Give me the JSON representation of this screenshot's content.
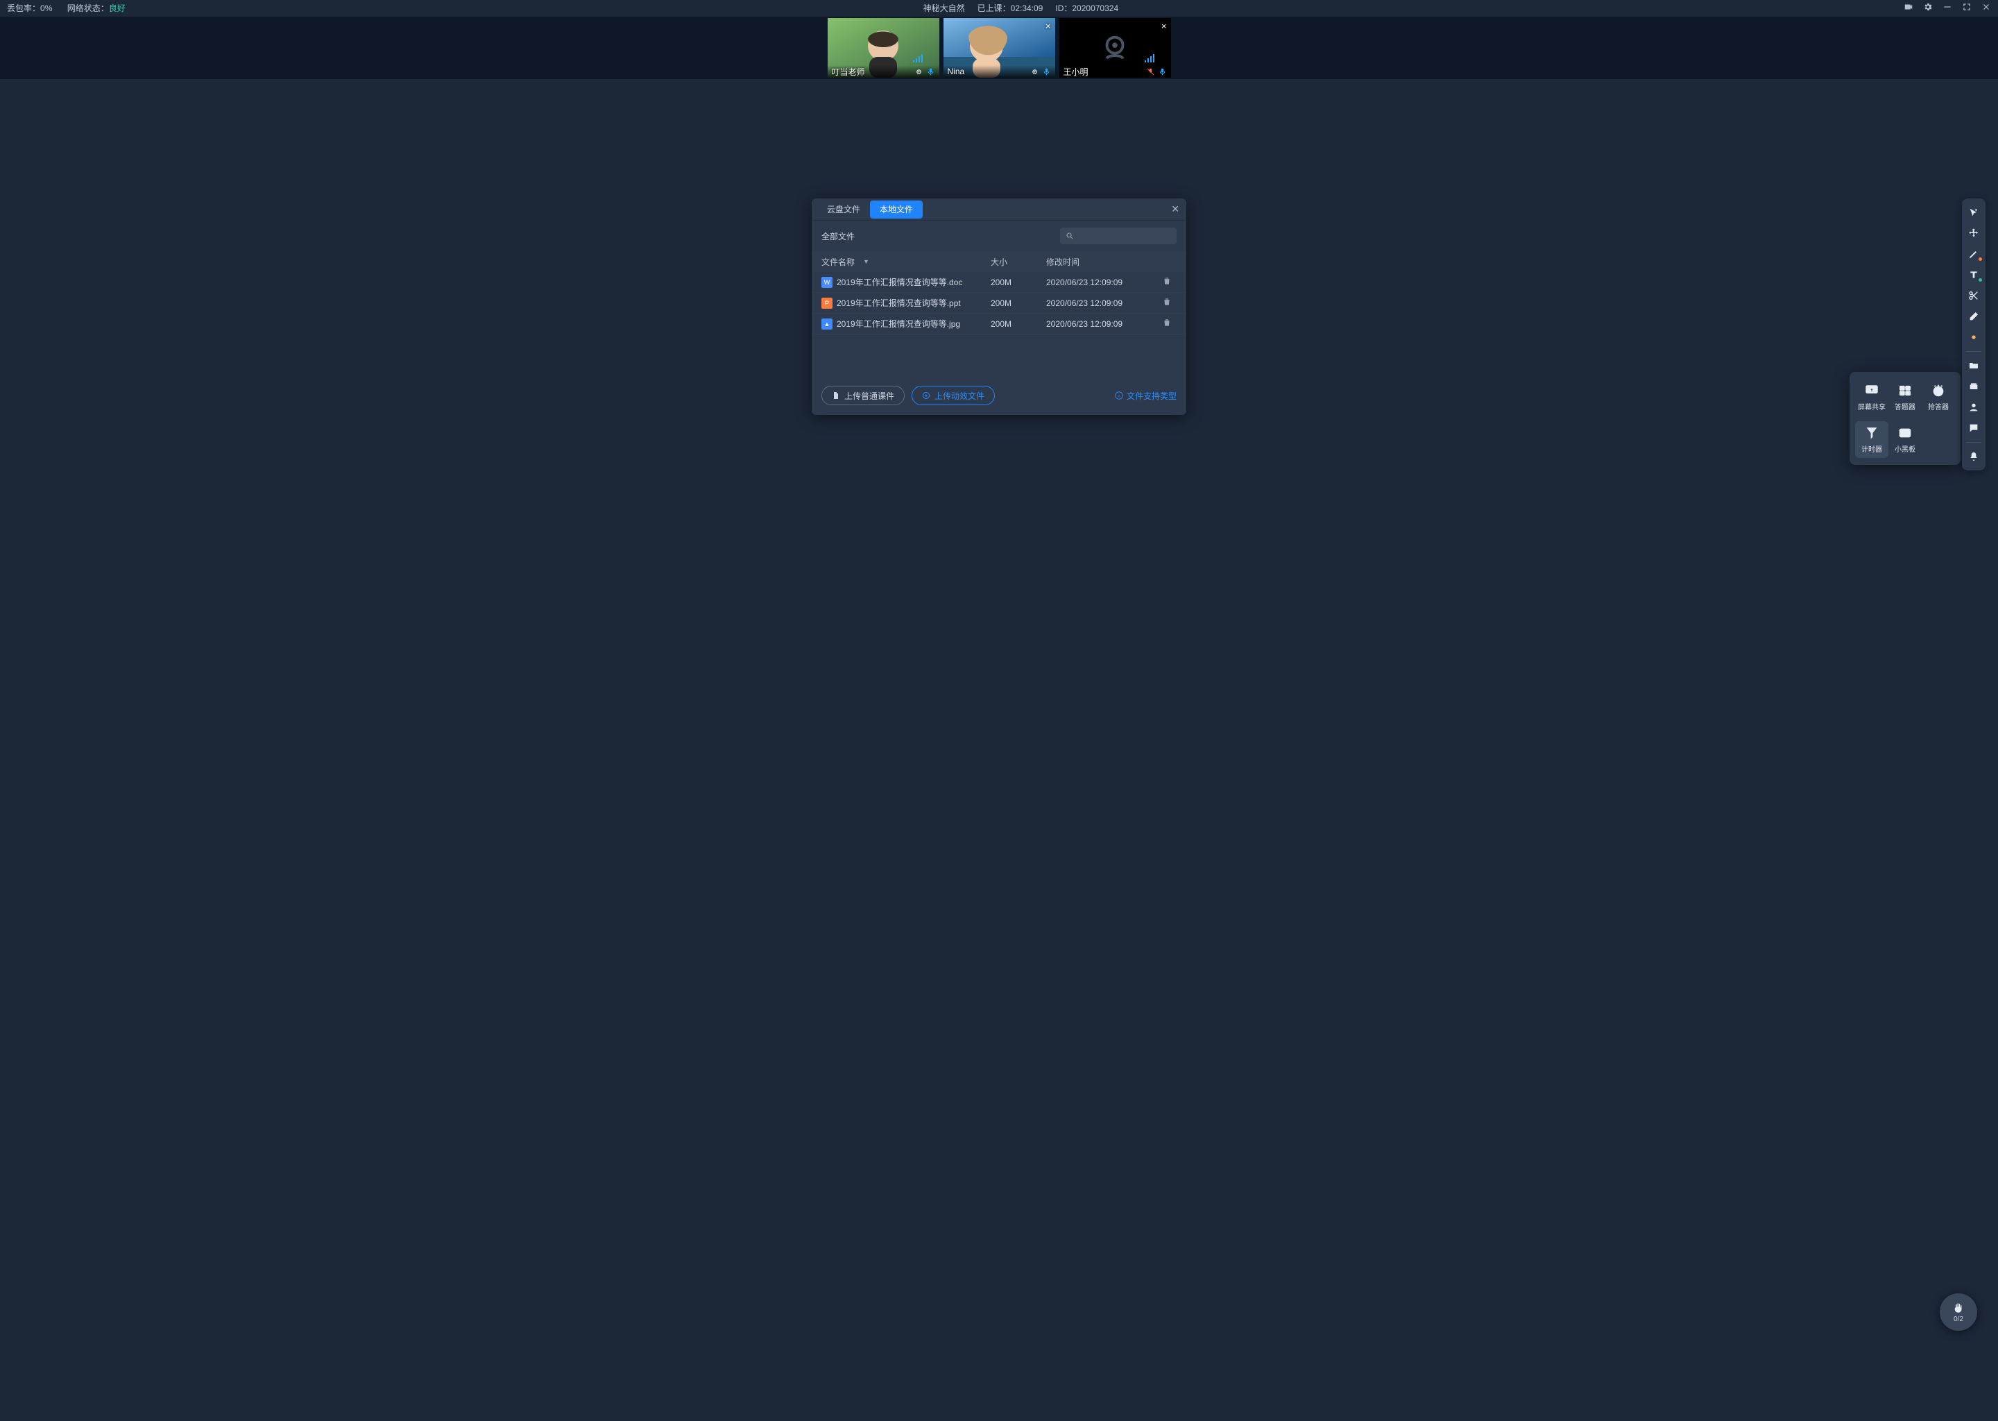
{
  "topbar": {
    "packet_loss_label": "丢包率：",
    "packet_loss_value": "0%",
    "network_label": "网络状态：",
    "network_value": "良好",
    "title": "神秘大自然",
    "class_time_label": "已上课：",
    "class_time_value": "02:34:09",
    "id_label": "ID：",
    "id_value": "2020070324"
  },
  "videos": [
    {
      "name": "叮当老师",
      "has_close": false,
      "dark": false,
      "muted": false,
      "bg": "avatar-1"
    },
    {
      "name": "Nina",
      "has_close": true,
      "dark": false,
      "muted": false,
      "bg": "avatar-2"
    },
    {
      "name": "王小明",
      "has_close": true,
      "dark": true,
      "muted": true,
      "bg": "camera-off"
    }
  ],
  "modal": {
    "tabs": {
      "cloud": "云盘文件",
      "local": "本地文件"
    },
    "all_files": "全部文件",
    "columns": {
      "name": "文件名称",
      "size": "大小",
      "time": "修改时间"
    },
    "rows": [
      {
        "icon": "doc",
        "name": "2019年工作汇报情况查询等等.doc",
        "size": "200M",
        "time": "2020/06/23 12:09:09"
      },
      {
        "icon": "ppt",
        "name": "2019年工作汇报情况查询等等.ppt",
        "size": "200M",
        "time": "2020/06/23 12:09:09"
      },
      {
        "icon": "jpg",
        "name": "2019年工作汇报情况查询等等.jpg",
        "size": "200M",
        "time": "2020/06/23 12:09:09"
      }
    ],
    "icon_glyph": {
      "doc": "W",
      "ppt": "P",
      "jpg": "▲"
    },
    "btn_upload_normal": "上传普通课件",
    "btn_upload_anim": "上传动效文件",
    "link_support": "文件支持类型"
  },
  "popover": [
    {
      "key": "screen-share",
      "label": "屏幕共享"
    },
    {
      "key": "answer",
      "label": "答题器"
    },
    {
      "key": "buzzer",
      "label": "抢答器"
    },
    {
      "key": "timer",
      "label": "计时器",
      "active": true
    },
    {
      "key": "board",
      "label": "小黑板"
    }
  ],
  "toolbar": [
    {
      "key": "cursor-sparkle"
    },
    {
      "key": "move"
    },
    {
      "key": "pen",
      "orange": true
    },
    {
      "key": "text",
      "teal": true
    },
    {
      "key": "scissors"
    },
    {
      "key": "eraser"
    },
    {
      "key": "dot"
    },
    {
      "divider": true
    },
    {
      "key": "folder"
    },
    {
      "key": "apps"
    },
    {
      "key": "user"
    },
    {
      "key": "chat"
    },
    {
      "divider": true
    },
    {
      "key": "bell"
    }
  ],
  "fab": {
    "count": "0/2"
  }
}
